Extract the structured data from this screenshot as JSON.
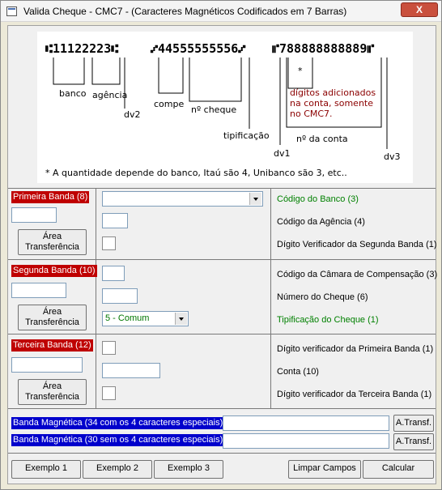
{
  "window": {
    "title": "Valida Cheque - CMC7 - (Caracteres Magnéticos Codificados em 7 Barras)",
    "close_label": "X"
  },
  "diagram": {
    "group1_code": "⑆11122223⑆",
    "group2_code": "⑇44555555556⑇",
    "group3_code": "⑈788888888889⑈",
    "labels": {
      "banco": "banco",
      "agencia": "agência",
      "dv2": "dv2",
      "compe": "compe",
      "no_cheque": "nº cheque",
      "tipificacao": "tipificação",
      "dv1": "dv1",
      "asterisk": "*",
      "note_line1": "dígitos adicionados",
      "note_line2": "na conta, somente",
      "note_line3": "no CMC7.",
      "no_conta": "nº da conta",
      "dv3": "dv3"
    },
    "footnote": "* A quantidade depende do banco, Itaú são 4, Unibanco são 3, etc.."
  },
  "band1": {
    "title": "Primeira Banda (8)",
    "transfer_line1": "Área",
    "transfer_line2": "Transferência",
    "fields": [
      {
        "label": "Código do Banco (3)"
      },
      {
        "label": "Código da Agência (4)"
      },
      {
        "label": "Dígito Verificador da Segunda Banda (1)"
      }
    ]
  },
  "band2": {
    "title": "Segunda Banda (10)",
    "transfer_line1": "Área",
    "transfer_line2": "Transferência",
    "tipificacao_value": "5 - Comum",
    "fields": [
      {
        "label": "Código da Câmara de Compensação (3)"
      },
      {
        "label": "Número do Cheque (6)"
      },
      {
        "label": "Tipificação do Cheque (1)"
      }
    ]
  },
  "band3": {
    "title": "Terceira Banda (12)",
    "transfer_line1": "Área",
    "transfer_line2": "Transferência",
    "fields": [
      {
        "label": "Dígito verificador da Primeira Banda (1)"
      },
      {
        "label": "Conta (10)"
      },
      {
        "label": "Dígito verificador da Terceira Banda (1)"
      }
    ]
  },
  "magnetic": {
    "band34_label": "Banda Magnética (34 com os 4 caracteres especiais)",
    "band30_label": "Banda Magnética (30 sem os 4 caracteres especiais)",
    "transfer_button": "A.Transf."
  },
  "buttons": {
    "exemplo1": "Exemplo 1",
    "exemplo2": "Exemplo 2",
    "exemplo3": "Exemplo 3",
    "limpar": "Limpar Campos",
    "calcular": "Calcular"
  },
  "colors": {
    "band_label_bg": "#bf0000",
    "magnetic_label_bg": "#0000cc",
    "green_label": "#008000",
    "note_text": "#8b0000"
  }
}
